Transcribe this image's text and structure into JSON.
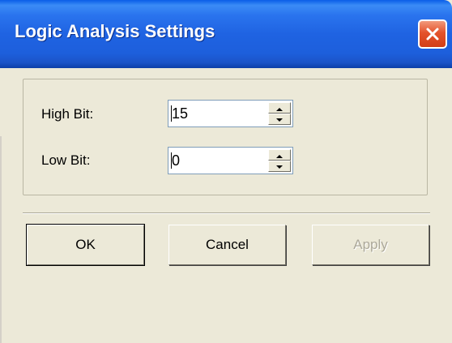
{
  "window": {
    "title": "Logic Analysis Settings",
    "close_label": "✕"
  },
  "fields": {
    "high_bit": {
      "label": "High Bit:",
      "value": "15"
    },
    "low_bit": {
      "label": "Low Bit:",
      "value": "0"
    }
  },
  "buttons": {
    "ok": "OK",
    "cancel": "Cancel",
    "apply": "Apply"
  },
  "colors": {
    "titlebar": "#2a74ee",
    "close_button": "#e4532c",
    "dialog_face": "#ece9d8"
  },
  "icons": {
    "close": "close-icon",
    "spin_up": "spin-up-arrow-icon",
    "spin_down": "spin-down-arrow-icon"
  }
}
